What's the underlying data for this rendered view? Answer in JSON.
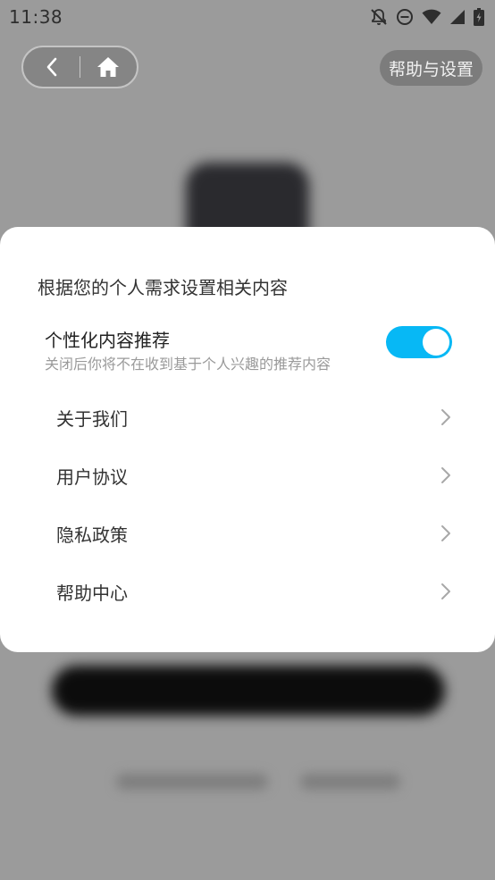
{
  "status_bar": {
    "time": "11:38",
    "icons": [
      "notifications-off-icon",
      "do-not-disturb-icon",
      "wifi-icon",
      "signal-icon",
      "battery-icon"
    ]
  },
  "nav": {
    "back_icon": "chevron-left-icon",
    "home_icon": "home-icon",
    "help_settings_label": "帮助与设置"
  },
  "sheet": {
    "title": "根据您的个人需求设置相关内容",
    "personalized": {
      "title": "个性化内容推荐",
      "description": "关闭后你将不在收到基于个人兴趣的推荐内容",
      "enabled": true
    },
    "items": [
      {
        "label": "关于我们"
      },
      {
        "label": "用户协议"
      },
      {
        "label": "隐私政策"
      },
      {
        "label": "帮助中心"
      }
    ]
  },
  "colors": {
    "accent": "#07b8f5",
    "overlay": "#9b9b9b",
    "sheet_bg": "#ffffff"
  }
}
